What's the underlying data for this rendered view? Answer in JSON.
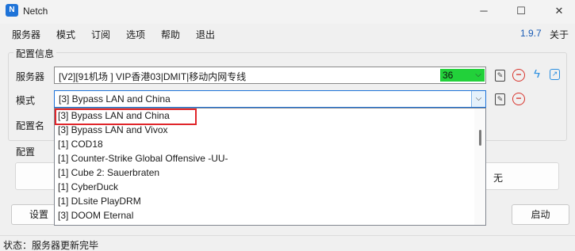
{
  "window": {
    "title": "Netch",
    "minimize": "─",
    "maximize": "☐",
    "close": "✕"
  },
  "menu": {
    "items": [
      "服务器",
      "模式",
      "订阅",
      "选项",
      "帮助",
      "退出"
    ],
    "version": "1.9.7",
    "about": "关于"
  },
  "config": {
    "group_title": "配置信息",
    "server_label": "服务器",
    "server_value": "[V2][91机场 ] VIP香港03|DMIT|移动内网专线",
    "latency": "36",
    "mode_label": "模式",
    "mode_value": "[3] Bypass LAN and China",
    "profile_label": "配置名"
  },
  "profiles": {
    "group_title": "配置",
    "none_label": "无"
  },
  "buttons": {
    "settings": "设置",
    "start": "启动"
  },
  "status": {
    "text": "状态：服务器更新完毕"
  },
  "mode_options": [
    "[3] Bypass LAN and China",
    "[3] Bypass LAN and Vivox",
    "[1] COD18",
    "[1] Counter-Strike Global Offensive -UU-",
    "[1] Cube 2: Sauerbraten",
    "[1] CyberDuck",
    "[1] DLsite PlayDRM",
    "[3] DOOM Eternal"
  ],
  "highlight_color": "#e0262b",
  "latency_color": "#22d13a",
  "accent_color": "#1e73d8"
}
